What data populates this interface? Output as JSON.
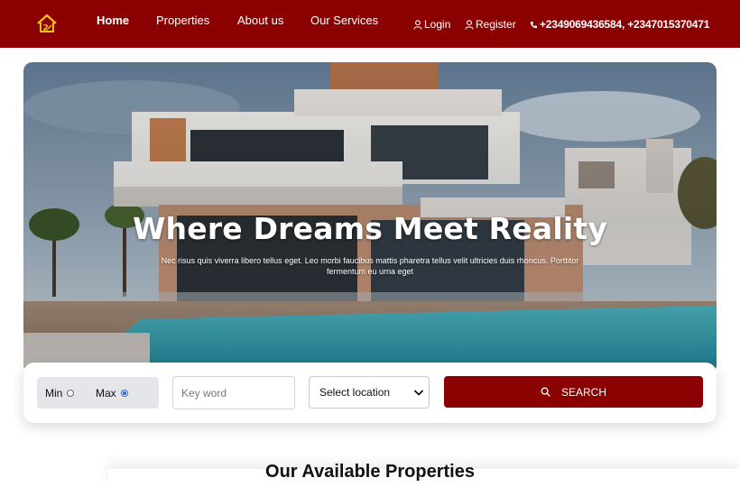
{
  "colors": {
    "brand": "#8b0000",
    "logo_accent": "#f5c518",
    "radio_checked": "#2b62d9"
  },
  "navbar": {
    "logo_icon": "house-logo-icon",
    "links": [
      {
        "label": "Home",
        "active": true
      },
      {
        "label": "Properties",
        "active": false
      },
      {
        "label": "About us",
        "active": false
      },
      {
        "label": "Our Services",
        "active": false
      }
    ],
    "login_label": "Login",
    "register_label": "Register",
    "phone_text": "+2349069436584, +2347015370471",
    "icons": [
      "user-icon",
      "phone-icon"
    ]
  },
  "hero": {
    "title": "Where Dreams Meet Reality",
    "subtitle": "Nec risus quis viverra libero tellus eget. Leo morbi faucibus mattis pharetra tellus velit ultricies duis rhoncus. Porttitor fermentum eu urna eget"
  },
  "search": {
    "price_options": [
      {
        "label": "Min",
        "checked": false
      },
      {
        "label": "Max",
        "checked": true
      }
    ],
    "keyword_placeholder": "Key word",
    "keyword_value": "",
    "location_selected": "Select location",
    "search_label": "SEARCH",
    "search_icon": "search-icon"
  },
  "section": {
    "title": "Our Available Properties"
  }
}
